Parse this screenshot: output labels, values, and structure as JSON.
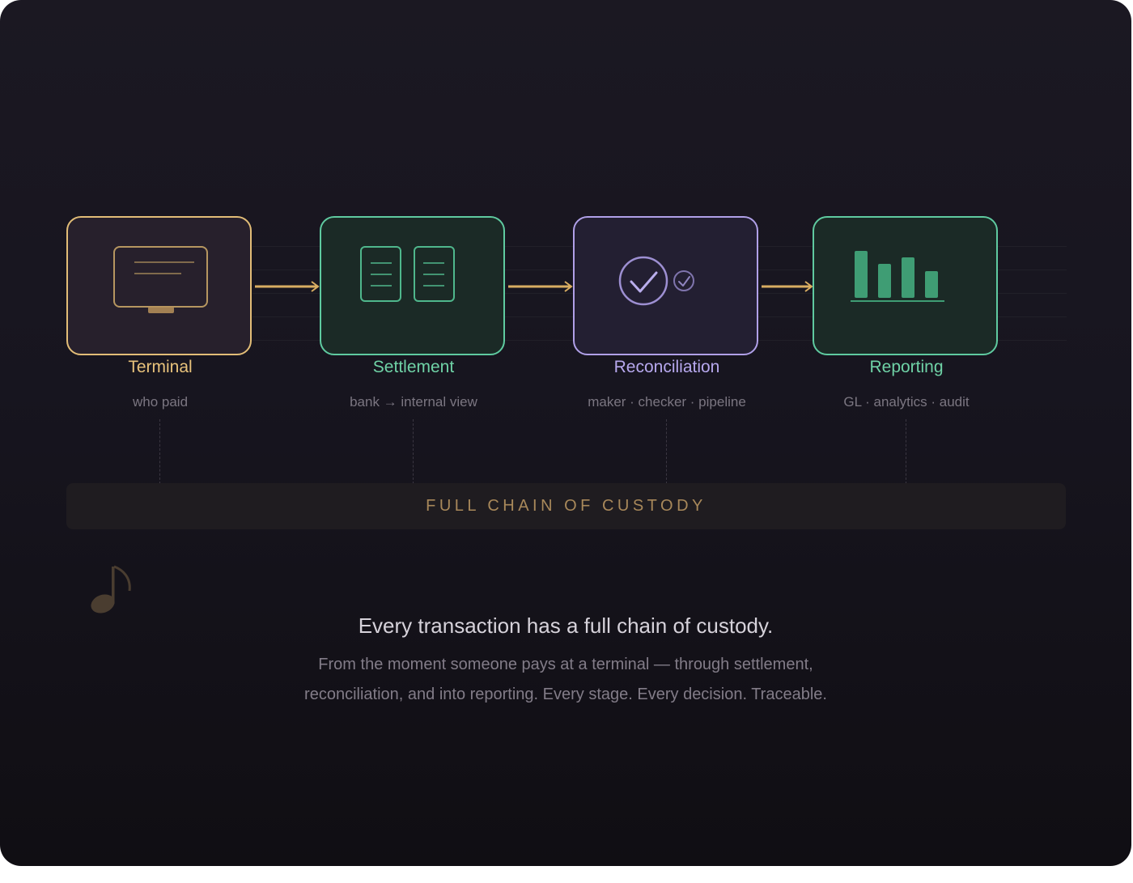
{
  "stages": [
    {
      "title": "Terminal",
      "subtitle": "who paid",
      "icon": "monitor-icon"
    },
    {
      "title": "Settlement",
      "subtitle": "bank → internal view",
      "icon": "documents-icon"
    },
    {
      "title": "Reconciliation",
      "subtitle": "maker · checker · pipeline",
      "icon": "double-check-icon"
    },
    {
      "title": "Reporting",
      "subtitle": "GL · analytics · audit",
      "icon": "bar-chart-icon"
    }
  ],
  "custody_bar": {
    "label": "FULL CHAIN OF CUSTODY"
  },
  "headline": "Every transaction has a full chain of custody.",
  "body": {
    "line1": "From the moment someone pays at a terminal — through settlement,",
    "line2": "reconciliation, and into reporting. Every stage. Every decision. Traceable."
  },
  "colors": {
    "gold": "#e2bd77",
    "green": "#5fcaa0",
    "lavender": "#b0a0e8",
    "background": "#17151f"
  }
}
